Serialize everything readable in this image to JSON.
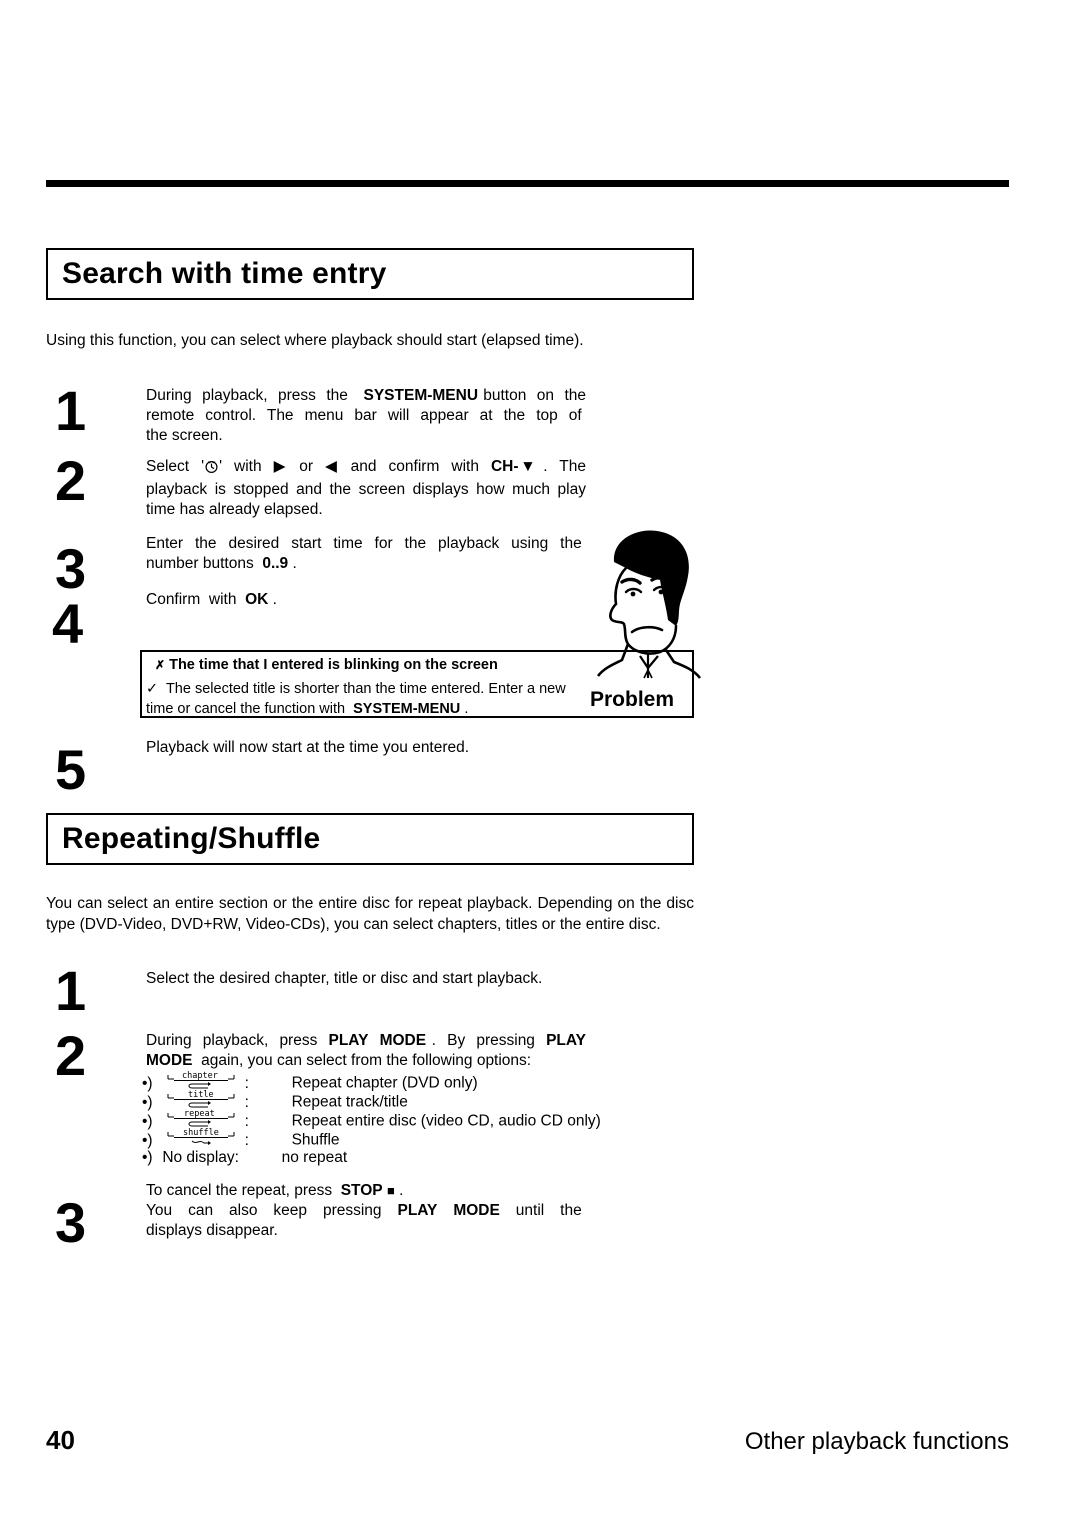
{
  "page": {
    "number": "40",
    "footer_title": "Other playback functions"
  },
  "sections": [
    {
      "id": "search",
      "title": "Search with time entry",
      "intro": "Using this function, you can select where playback should start (elapsed time).",
      "steps": [
        {
          "num": "1",
          "text_parts": [
            "During  playback,  press  the  ",
            "SYSTEM-MENU",
            " button  on  the remote  control.  The  menu  bar  will  appear  at  the  top  of  the screen."
          ]
        },
        {
          "num": "2",
          "text_parts": [
            "Select  '",
            "clock-icon",
            "'  with  ",
            "▶",
            "  or  ",
            "◀",
            "  and  confirm  with  ",
            "CH-",
            "▼",
            " .  The playback is stopped and the screen displays how much play time has already elapsed."
          ]
        },
        {
          "num": "3",
          "text_parts": [
            "Enter  the  desired  start  time  for  the  playback  using  the  number buttons  ",
            "0..9",
            " ."
          ]
        },
        {
          "num": "4",
          "text_parts": [
            "Confirm  with  ",
            "OK",
            " ."
          ]
        },
        {
          "num": "5",
          "text_parts": [
            "Playback will now start at the time you entered."
          ]
        }
      ]
    },
    {
      "id": "repeat",
      "title": "Repeating/Shuffle",
      "intro": "You can select an entire section or the entire disc for repeat playback. Depending on the disc type (DVD-Video, DVD+RW, Video-CDs), you can select chapters, titles or the entire disc.",
      "steps": [
        {
          "num": "1",
          "text_parts": [
            "Select the desired chapter, title or disc and start playback."
          ]
        },
        {
          "num": "2",
          "text_parts": [
            "During  playback,  press  ",
            "PLAY  MODE",
            " .  By  pressing  ",
            "PLAY MODE",
            "  again, you can select from the following options:"
          ]
        },
        {
          "num": "3",
          "text_parts": [
            "To cancel the repeat, press  ",
            "STOP",
            " ",
            "■",
            " .",
            "You  can  also  keep  pressing  ",
            "PLAY  MODE",
            "  until  the  displays disappear."
          ]
        }
      ]
    }
  ],
  "problem": {
    "marker": "✗",
    "title": "The time that I entered is blinking on the screen",
    "check": "✓",
    "body_parts": [
      "The selected title is shorter than the time entered. Enter a new time or cancel the function with  ",
      "SYSTEM-MENU",
      " ."
    ],
    "label": "Problem"
  },
  "repeat_options": [
    {
      "bullet": "•)",
      "icon_label": "chapter",
      "icon_type": "box",
      "desc": "Repeat chapter (DVD only)"
    },
    {
      "bullet": "•)",
      "icon_label": "title",
      "icon_type": "box",
      "desc": "Repeat track/title"
    },
    {
      "bullet": "•)",
      "icon_label": "repeat",
      "icon_type": "box",
      "desc": "Repeat entire disc (video CD, audio CD only)"
    },
    {
      "bullet": "•)",
      "icon_label": "shuffle",
      "icon_type": "box",
      "desc": "Shuffle"
    },
    {
      "bullet": "•)",
      "icon_label": "No display:",
      "icon_type": "text",
      "desc": "no repeat"
    }
  ],
  "colors": {
    "text": "#000000",
    "background": "#ffffff"
  }
}
